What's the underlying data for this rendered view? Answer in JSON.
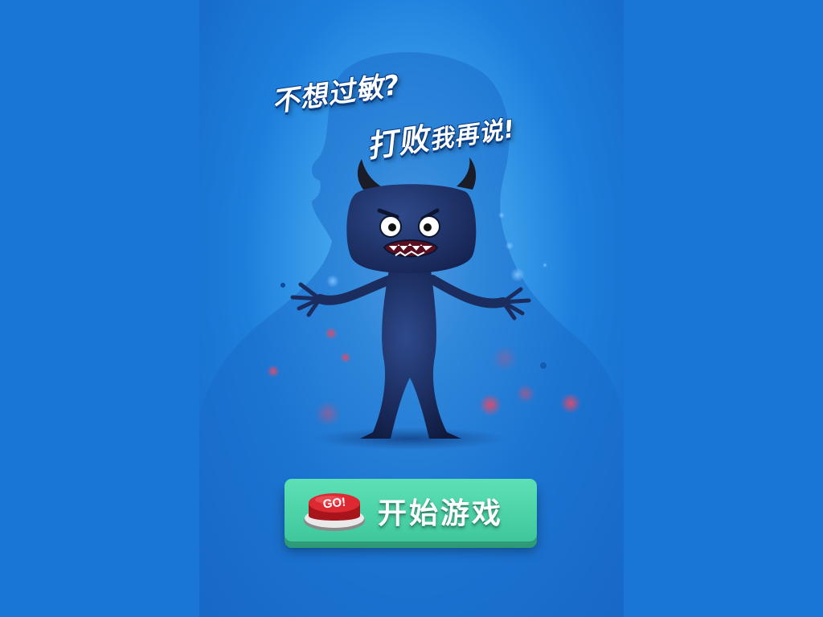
{
  "headline": {
    "line1": "不想过敏?",
    "line2_big": "打败",
    "line2_small": "我再说!"
  },
  "start_button": {
    "go_label": "GO!",
    "label": "开始游戏"
  },
  "colors": {
    "outer_background": "#1976d6",
    "monster_body": "#1d2c5c",
    "button_green": "#4fd4aa",
    "go_button_red": "#d8222a"
  },
  "icons": {
    "go_button": "red-go-button-icon"
  }
}
